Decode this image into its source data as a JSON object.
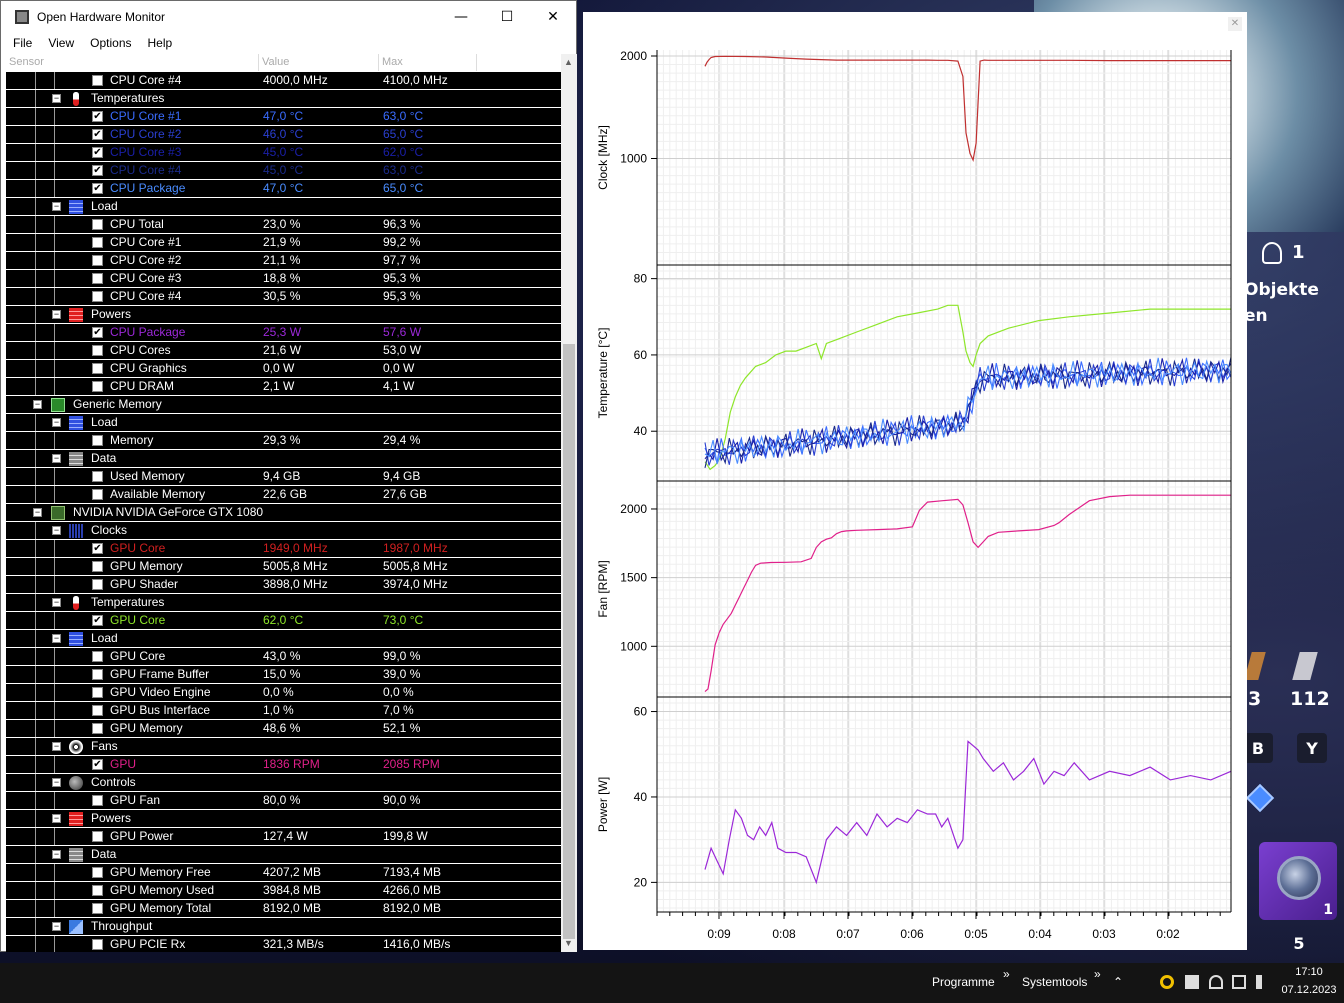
{
  "ohm": {
    "title": "Open Hardware Monitor",
    "menu": [
      "File",
      "View",
      "Options",
      "Help"
    ],
    "columns": {
      "sensor": "Sensor",
      "value": "Value",
      "max": "Max"
    },
    "rows": [
      {
        "type": "sensor",
        "indent": 2,
        "label": "CPU Core #4",
        "value": "4000,0 MHz",
        "max": "4100,0 MHz",
        "checked": false,
        "color": "#ffffff"
      },
      {
        "type": "category",
        "indent": 1,
        "label": "Temperatures",
        "icon": "thermometer-icon"
      },
      {
        "type": "sensor",
        "indent": 2,
        "label": "CPU Core #1",
        "value": "47,0 °C",
        "max": "63,0 °C",
        "checked": true,
        "color": "#3a6cff"
      },
      {
        "type": "sensor",
        "indent": 2,
        "label": "CPU Core #2",
        "value": "46,0 °C",
        "max": "65,0 °C",
        "checked": true,
        "color": "#2a3fd0"
      },
      {
        "type": "sensor",
        "indent": 2,
        "label": "CPU Core #3",
        "value": "45,0 °C",
        "max": "62,0 °C",
        "checked": true,
        "color": "#1a1fa8"
      },
      {
        "type": "sensor",
        "indent": 2,
        "label": "CPU Core #4",
        "value": "45,0 °C",
        "max": "63,0 °C",
        "checked": true,
        "color": "#1a2a8a"
      },
      {
        "type": "sensor",
        "indent": 2,
        "label": "CPU Package",
        "value": "47,0 °C",
        "max": "65,0 °C",
        "checked": true,
        "color": "#4a8cff"
      },
      {
        "type": "category",
        "indent": 1,
        "label": "Load",
        "icon": "load-icon"
      },
      {
        "type": "sensor",
        "indent": 2,
        "label": "CPU Total",
        "value": "23,0 %",
        "max": "96,3 %",
        "checked": false,
        "color": "#ffffff"
      },
      {
        "type": "sensor",
        "indent": 2,
        "label": "CPU Core #1",
        "value": "21,9 %",
        "max": "99,2 %",
        "checked": false,
        "color": "#ffffff"
      },
      {
        "type": "sensor",
        "indent": 2,
        "label": "CPU Core #2",
        "value": "21,1 %",
        "max": "97,7 %",
        "checked": false,
        "color": "#ffffff"
      },
      {
        "type": "sensor",
        "indent": 2,
        "label": "CPU Core #3",
        "value": "18,8 %",
        "max": "95,3 %",
        "checked": false,
        "color": "#ffffff"
      },
      {
        "type": "sensor",
        "indent": 2,
        "label": "CPU Core #4",
        "value": "30,5 %",
        "max": "95,3 %",
        "checked": false,
        "color": "#ffffff"
      },
      {
        "type": "category",
        "indent": 1,
        "label": "Powers",
        "icon": "power-icon"
      },
      {
        "type": "sensor",
        "indent": 2,
        "label": "CPU Package",
        "value": "25,3 W",
        "max": "57,6 W",
        "checked": true,
        "color": "#9b28d8"
      },
      {
        "type": "sensor",
        "indent": 2,
        "label": "CPU Cores",
        "value": "21,6 W",
        "max": "53,0 W",
        "checked": false,
        "color": "#ffffff"
      },
      {
        "type": "sensor",
        "indent": 2,
        "label": "CPU Graphics",
        "value": "0,0 W",
        "max": "0,0 W",
        "checked": false,
        "color": "#ffffff"
      },
      {
        "type": "sensor",
        "indent": 2,
        "label": "CPU DRAM",
        "value": "2,1 W",
        "max": "4,1 W",
        "checked": false,
        "color": "#ffffff"
      },
      {
        "type": "hardware",
        "indent": 0,
        "label": "Generic Memory",
        "icon": "memory-chip-icon"
      },
      {
        "type": "category",
        "indent": 1,
        "label": "Load",
        "icon": "load-icon"
      },
      {
        "type": "sensor",
        "indent": 2,
        "label": "Memory",
        "value": "29,3 %",
        "max": "29,4 %",
        "checked": false,
        "color": "#ffffff"
      },
      {
        "type": "category",
        "indent": 1,
        "label": "Data",
        "icon": "data-icon"
      },
      {
        "type": "sensor",
        "indent": 2,
        "label": "Used Memory",
        "value": "9,4 GB",
        "max": "9,4 GB",
        "checked": false,
        "color": "#ffffff"
      },
      {
        "type": "sensor",
        "indent": 2,
        "label": "Available Memory",
        "value": "22,6 GB",
        "max": "27,6 GB",
        "checked": false,
        "color": "#ffffff"
      },
      {
        "type": "hardware",
        "indent": 0,
        "label": "NVIDIA NVIDIA GeForce GTX 1080",
        "icon": "gpu-icon"
      },
      {
        "type": "category",
        "indent": 1,
        "label": "Clocks",
        "icon": "clock-icon"
      },
      {
        "type": "sensor",
        "indent": 2,
        "label": "GPU Core",
        "value": "1949,0 MHz",
        "max": "1987,0 MHz",
        "checked": true,
        "color": "#d02020"
      },
      {
        "type": "sensor",
        "indent": 2,
        "label": "GPU Memory",
        "value": "5005,8 MHz",
        "max": "5005,8 MHz",
        "checked": false,
        "color": "#ffffff"
      },
      {
        "type": "sensor",
        "indent": 2,
        "label": "GPU Shader",
        "value": "3898,0 MHz",
        "max": "3974,0 MHz",
        "checked": false,
        "color": "#ffffff"
      },
      {
        "type": "category",
        "indent": 1,
        "label": "Temperatures",
        "icon": "thermometer-icon"
      },
      {
        "type": "sensor",
        "indent": 2,
        "label": "GPU Core",
        "value": "62,0 °C",
        "max": "73,0 °C",
        "checked": true,
        "color": "#8ee62a"
      },
      {
        "type": "category",
        "indent": 1,
        "label": "Load",
        "icon": "load-icon"
      },
      {
        "type": "sensor",
        "indent": 2,
        "label": "GPU Core",
        "value": "43,0 %",
        "max": "99,0 %",
        "checked": false,
        "color": "#ffffff"
      },
      {
        "type": "sensor",
        "indent": 2,
        "label": "GPU Frame Buffer",
        "value": "15,0 %",
        "max": "39,0 %",
        "checked": false,
        "color": "#ffffff"
      },
      {
        "type": "sensor",
        "indent": 2,
        "label": "GPU Video Engine",
        "value": "0,0 %",
        "max": "0,0 %",
        "checked": false,
        "color": "#ffffff"
      },
      {
        "type": "sensor",
        "indent": 2,
        "label": "GPU Bus Interface",
        "value": "1,0 %",
        "max": "7,0 %",
        "checked": false,
        "color": "#ffffff"
      },
      {
        "type": "sensor",
        "indent": 2,
        "label": "GPU Memory",
        "value": "48,6 %",
        "max": "52,1 %",
        "checked": false,
        "color": "#ffffff"
      },
      {
        "type": "category",
        "indent": 1,
        "label": "Fans",
        "icon": "fan-icon"
      },
      {
        "type": "sensor",
        "indent": 2,
        "label": "GPU",
        "value": "1836 RPM",
        "max": "2085 RPM",
        "checked": true,
        "color": "#e0208a"
      },
      {
        "type": "category",
        "indent": 1,
        "label": "Controls",
        "icon": "control-icon"
      },
      {
        "type": "sensor",
        "indent": 2,
        "label": "GPU Fan",
        "value": "80,0 %",
        "max": "90,0 %",
        "checked": false,
        "color": "#ffffff"
      },
      {
        "type": "category",
        "indent": 1,
        "label": "Powers",
        "icon": "power-icon"
      },
      {
        "type": "sensor",
        "indent": 2,
        "label": "GPU Power",
        "value": "127,4 W",
        "max": "199,8 W",
        "checked": false,
        "color": "#ffffff"
      },
      {
        "type": "category",
        "indent": 1,
        "label": "Data",
        "icon": "data-icon"
      },
      {
        "type": "sensor",
        "indent": 2,
        "label": "GPU Memory Free",
        "value": "4207,2 MB",
        "max": "7193,4 MB",
        "checked": false,
        "color": "#ffffff"
      },
      {
        "type": "sensor",
        "indent": 2,
        "label": "GPU Memory Used",
        "value": "3984,8 MB",
        "max": "4266,0 MB",
        "checked": false,
        "color": "#ffffff"
      },
      {
        "type": "sensor",
        "indent": 2,
        "label": "GPU Memory Total",
        "value": "8192,0 MB",
        "max": "8192,0 MB",
        "checked": false,
        "color": "#ffffff"
      },
      {
        "type": "category",
        "indent": 1,
        "label": "Throughput",
        "icon": "throughput-icon"
      },
      {
        "type": "sensor",
        "indent": 2,
        "label": "GPU PCIE Rx",
        "value": "321,3 MB/s",
        "max": "1416,0 MB/s",
        "checked": false,
        "color": "#ffffff"
      }
    ]
  },
  "game": {
    "players_count": "1",
    "objekte_text": "Objekte",
    "en_text": "en",
    "mat_count_1": "3",
    "mat_count_2": "112",
    "key_b": "B",
    "key_y": "Y",
    "item_count": "1",
    "slot_key": "5"
  },
  "taskbar": {
    "programme": "Programme",
    "systemtools": "Systemtools",
    "time": "17:10",
    "date": "07.12.2023"
  },
  "chart_data": {
    "type": "line",
    "x_ticks": [
      "0:09",
      "0:08",
      "0:07",
      "0:06",
      "0:05",
      "0:04",
      "0:03",
      "0:02"
    ],
    "panels": [
      {
        "ylabel": "Clock [MHz]",
        "ylim": [
          0,
          2000
        ],
        "yticks": [
          1000,
          2000
        ],
        "series": [
          {
            "name": "GPU Core",
            "color": "#c03030",
            "x": [
              0,
              2,
              4,
              6,
              10,
              20,
              40,
              60,
              80,
              100,
              130,
              160,
              200,
              220,
              230,
              240,
              250,
              255,
              258,
              262,
              265,
              268,
              272,
              276,
              280,
              290,
              320,
              360,
              400,
              440,
              480,
              520
            ],
            "y": [
              1900,
              1940,
              1965,
              1985,
              1995,
              1997,
              1995,
              1990,
              1980,
              1970,
              1960,
              1960,
              1960,
              1960,
              1958,
              1958,
              1950,
              1800,
              1250,
              1050,
              985,
              1150,
              1950,
              1960,
              1958,
              1958,
              1958,
              1958,
              1955,
              1955,
              1955,
              1955
            ]
          }
        ]
      },
      {
        "ylabel": "Temperature [°C]",
        "ylim": [
          28,
          82
        ],
        "yticks": [
          40,
          60,
          80
        ],
        "series": [
          {
            "name": "GPU Core",
            "color": "#8ee62a",
            "x": [
              0,
              5,
              10,
              15,
              20,
              25,
              30,
              35,
              40,
              50,
              60,
              70,
              80,
              90,
              100,
              110,
              115,
              120,
              130,
              150,
              170,
              190,
              210,
              230,
              240,
              250,
              255,
              258,
              262,
              265,
              268,
              272,
              280,
              300,
              330,
              360,
              400,
              440,
              480,
              520
            ],
            "y": [
              32,
              30,
              31,
              33,
              38,
              45,
              49,
              52,
              54,
              57,
              58,
              60,
              61,
              61,
              62,
              63,
              59,
              63,
              64,
              66,
              68,
              70,
              71,
              72,
              73,
              73,
              66,
              61,
              58,
              57,
              60,
              63,
              65,
              67,
              69,
              70,
              71,
              72,
              72,
              72
            ]
          }
        ]
      },
      {
        "ylabel": "Fan [RPM]",
        "ylim": [
          660,
          2160
        ],
        "yticks": [
          1000,
          1500,
          2000
        ],
        "series": [
          {
            "name": "GPU",
            "color": "#e0208a",
            "x": [
              0,
              3,
              6,
              10,
              14,
              18,
              22,
              26,
              30,
              34,
              38,
              42,
              46,
              50,
              55,
              65,
              80,
              95,
              105,
              110,
              115,
              120,
              125,
              130,
              135,
              140,
              150,
              170,
              190,
              205,
              212,
              220,
              235,
              250,
              255,
              260,
              265,
              270,
              275,
              280,
              290,
              310,
              330,
              345,
              350,
              360,
              380,
              400,
              420,
              440,
              460,
              480,
              500,
              520
            ],
            "y": [
              670,
              690,
              820,
              1010,
              1100,
              1160,
              1200,
              1240,
              1300,
              1360,
              1420,
              1480,
              1540,
              1590,
              1605,
              1610,
              1612,
              1615,
              1640,
              1720,
              1760,
              1780,
              1790,
              1820,
              1835,
              1840,
              1845,
              1850,
              1855,
              1870,
              1990,
              2050,
              2060,
              2070,
              2030,
              1900,
              1760,
              1720,
              1760,
              1800,
              1830,
              1840,
              1850,
              1880,
              1900,
              1960,
              2060,
              2090,
              2100,
              2100,
              2100,
              2100,
              2100,
              2100
            ]
          }
        ]
      },
      {
        "ylabel": "Power [W]",
        "ylim": [
          14,
          62
        ],
        "yticks": [
          20,
          40,
          60
        ],
        "series": [
          {
            "name": "CPU Package",
            "color": "#9b28d8",
            "x": [
              0,
              6,
              12,
              18,
              24,
              30,
              36,
              42,
              48,
              54,
              60,
              66,
              72,
              80,
              90,
              100,
              110,
              120,
              130,
              140,
              150,
              160,
              170,
              180,
              190,
              200,
              210,
              220,
              228,
              234,
              240,
              250,
              255,
              260,
              265,
              270,
              275,
              285,
              295,
              305,
              315,
              325,
              335,
              345,
              355,
              365,
              380,
              400,
              420,
              440,
              460,
              480,
              500,
              520
            ],
            "y": [
              23,
              28,
              25,
              22,
              30,
              37,
              35,
              31,
              30,
              33,
              31,
              34,
              28,
              27,
              27,
              26,
              20,
              30,
              33,
              31,
              34,
              31,
              36,
              33,
              35,
              34,
              37,
              36,
              36,
              33,
              35,
              28,
              30,
              53,
              52,
              51,
              49,
              46,
              48,
              44,
              46,
              49,
              43,
              46,
              45,
              48,
              44,
              46,
              45,
              47,
              44,
              45,
              44,
              46
            ]
          },
          {
            "name": "",
            "color": "#9b28d8",
            "x": [],
            "y": []
          }
        ]
      }
    ]
  }
}
